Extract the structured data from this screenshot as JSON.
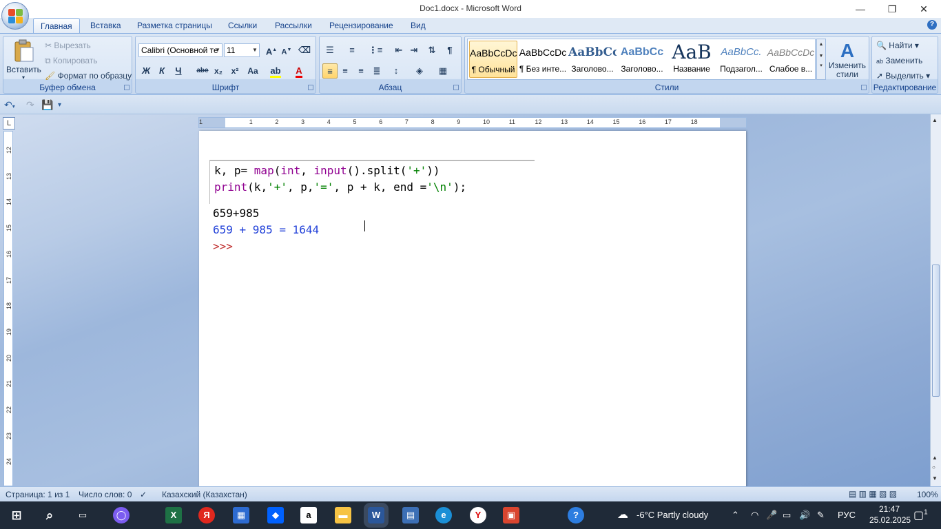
{
  "window": {
    "title": "Doc1.docx - Microsoft Word",
    "minimize": "—",
    "maximize": "❐",
    "close": "✕"
  },
  "tabs": [
    "Главная",
    "Вставка",
    "Разметка страницы",
    "Ссылки",
    "Рассылки",
    "Рецензирование",
    "Вид"
  ],
  "clipboard": {
    "label": "Буфер обмена",
    "paste": "Вставить",
    "cut": "Вырезать",
    "copy": "Копировать",
    "format_painter": "Формат по образцу"
  },
  "font": {
    "label": "Шрифт",
    "family": "Calibri (Основной те",
    "size": "11",
    "bold": "Ж",
    "italic": "К",
    "underline": "Ч",
    "strike": "abe",
    "sub": "x₂",
    "sup": "x²",
    "case": "Aa"
  },
  "paragraph": {
    "label": "Абзац"
  },
  "styles": {
    "label": "Стили",
    "items": [
      {
        "preview": "AaBbCcDc",
        "name": "¶ Обычный"
      },
      {
        "preview": "AaBbCcDc",
        "name": "¶ Без инте..."
      },
      {
        "preview": "AaBbCc",
        "name": "Заголово..."
      },
      {
        "preview": "AaBbCc",
        "name": "Заголово..."
      },
      {
        "preview": "AaB",
        "name": "Название"
      },
      {
        "preview": "AaBbCc.",
        "name": "Подзагол..."
      },
      {
        "preview": "AaBbCcDc",
        "name": "Слабое в..."
      }
    ],
    "change": "Изменить стили"
  },
  "editing": {
    "label": "Редактирование",
    "find": "Найти",
    "replace": "Заменить",
    "select": "Выделить"
  },
  "ruler": {
    "h_numbers": [
      "1",
      "1",
      "2",
      "3",
      "4",
      "5",
      "6",
      "7",
      "8",
      "9",
      "10",
      "11",
      "12",
      "13",
      "14",
      "15",
      "16",
      "17",
      "18"
    ],
    "v_numbers": [
      "12",
      "13",
      "14",
      "15",
      "16",
      "17",
      "18",
      "19",
      "20",
      "21",
      "22",
      "23",
      "24"
    ]
  },
  "document": {
    "code_line1": [
      {
        "t": "k, p= ",
        "c": "#000000"
      },
      {
        "t": "map",
        "c": "#900090"
      },
      {
        "t": "(",
        "c": "#000000"
      },
      {
        "t": "int",
        "c": "#900090"
      },
      {
        "t": ", ",
        "c": "#000000"
      },
      {
        "t": "input",
        "c": "#900090"
      },
      {
        "t": "().split(",
        "c": "#000000"
      },
      {
        "t": "'+'",
        "c": "#008000"
      },
      {
        "t": "))",
        "c": "#000000"
      }
    ],
    "code_line2": [
      {
        "t": "print",
        "c": "#900090"
      },
      {
        "t": "(k,",
        "c": "#000000"
      },
      {
        "t": "'+'",
        "c": "#008000"
      },
      {
        "t": ", p,",
        "c": "#000000"
      },
      {
        "t": "'='",
        "c": "#008000"
      },
      {
        "t": ", p + k, end =",
        "c": "#000000"
      },
      {
        "t": "'\\n'",
        "c": "#008000"
      },
      {
        "t": ");",
        "c": "#000000"
      }
    ],
    "input_line": "659+985",
    "output_line": "659 + 985 = 1644",
    "prompt": ">>>"
  },
  "status": {
    "page": "Страница: 1 из 1",
    "words": "Число слов: 0",
    "language": "Казахский (Казахстан)",
    "zoom": "100%"
  },
  "taskbar": {
    "weather": "-6°C  Partly cloudy",
    "lang": "РУС",
    "time": "21:47",
    "date": "25.02.2025",
    "notif": "1"
  }
}
